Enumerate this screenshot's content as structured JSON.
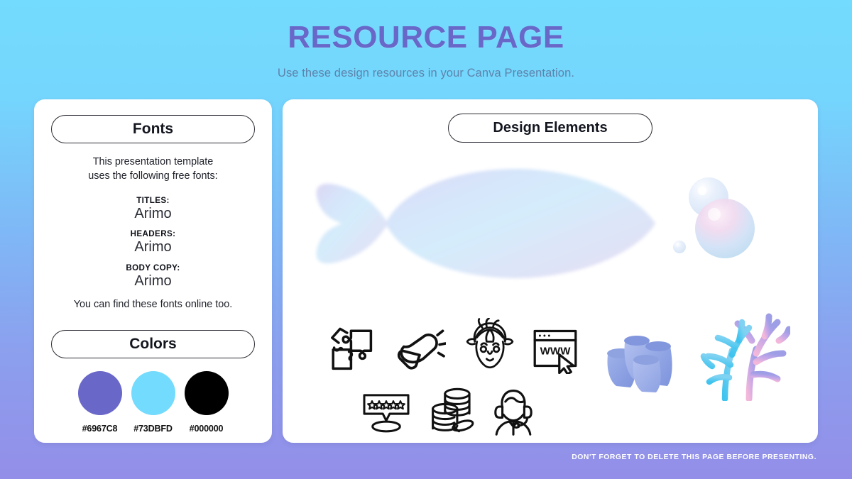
{
  "header": {
    "title": "RESOURCE PAGE",
    "subtitle": "Use these design resources in your Canva Presentation.",
    "title_color": "#6967C8",
    "subtitle_color": "#5E83AC"
  },
  "background": {
    "top_color": "#73DBFD",
    "bottom_color": "#938EE8"
  },
  "fonts_panel": {
    "pill_label": "Fonts",
    "intro_line1": "This presentation template",
    "intro_line2": "uses the following free fonts:",
    "entries": [
      {
        "label": "TITLES:",
        "value": "Arimo"
      },
      {
        "label": "HEADERS:",
        "value": "Arimo"
      },
      {
        "label": "BODY COPY:",
        "value": "Arimo"
      }
    ],
    "outro": "You can find these fonts online too."
  },
  "colors_panel": {
    "pill_label": "Colors",
    "swatches": [
      {
        "hex": "#6967C8",
        "label": "#6967C8"
      },
      {
        "hex": "#73DBFD",
        "label": "#73DBFD"
      },
      {
        "hex": "#000000",
        "label": "#000000"
      }
    ]
  },
  "design_elements": {
    "pill_label": "Design Elements",
    "illustrations": [
      {
        "name": "fish-illustration"
      },
      {
        "name": "bubbles-illustration"
      },
      {
        "name": "tube-sponge-illustration"
      },
      {
        "name": "coral-illustration"
      }
    ],
    "line_icons": [
      {
        "name": "puzzle-pieces-icon"
      },
      {
        "name": "megaphone-icon"
      },
      {
        "name": "woman-with-turban-icon"
      },
      {
        "name": "browser-www-icon",
        "text": "WWW"
      },
      {
        "name": "five-star-review-icon"
      },
      {
        "name": "coin-stack-icon"
      },
      {
        "name": "headset-support-agent-icon"
      }
    ]
  },
  "footer": {
    "note": "DON'T FORGET TO DELETE THIS PAGE BEFORE PRESENTING."
  }
}
